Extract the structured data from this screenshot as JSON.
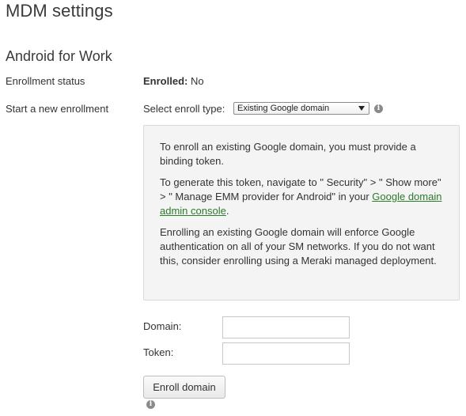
{
  "page": {
    "title": "MDM settings"
  },
  "section": {
    "title": "Android for Work"
  },
  "enrollment_status": {
    "label": "Enrollment status",
    "value_label": "Enrolled:",
    "value": "No"
  },
  "new_enrollment": {
    "label": "Start a new enrollment",
    "select_label": "Select enroll type:",
    "select_value": "Existing Google domain",
    "info_icon": "info-icon"
  },
  "info_panel": {
    "paragraph1": "To enroll an existing Google domain, you must provide a binding token.",
    "paragraph2_text": "To generate this token, navigate to \" Security\"  > \" Show more\"  > \" Manage EMM provider for Android\"  in your",
    "paragraph2_link": "Google domain admin console",
    "paragraph2_end": ".",
    "paragraph3": "Enrolling an existing Google domain will enforce Google authentication on all of your SM networks. If you do not want this, consider enrolling using a Meraki managed deployment."
  },
  "form": {
    "domain_label": "Domain:",
    "domain_value": "",
    "token_label": "Token:",
    "token_value": "",
    "enroll_button": "Enroll domain",
    "info_icon": "info-icon"
  },
  "colors": {
    "link": "#2c7a2c",
    "panel_background": "#f4f4f4",
    "panel_border": "#d9d9d9"
  }
}
